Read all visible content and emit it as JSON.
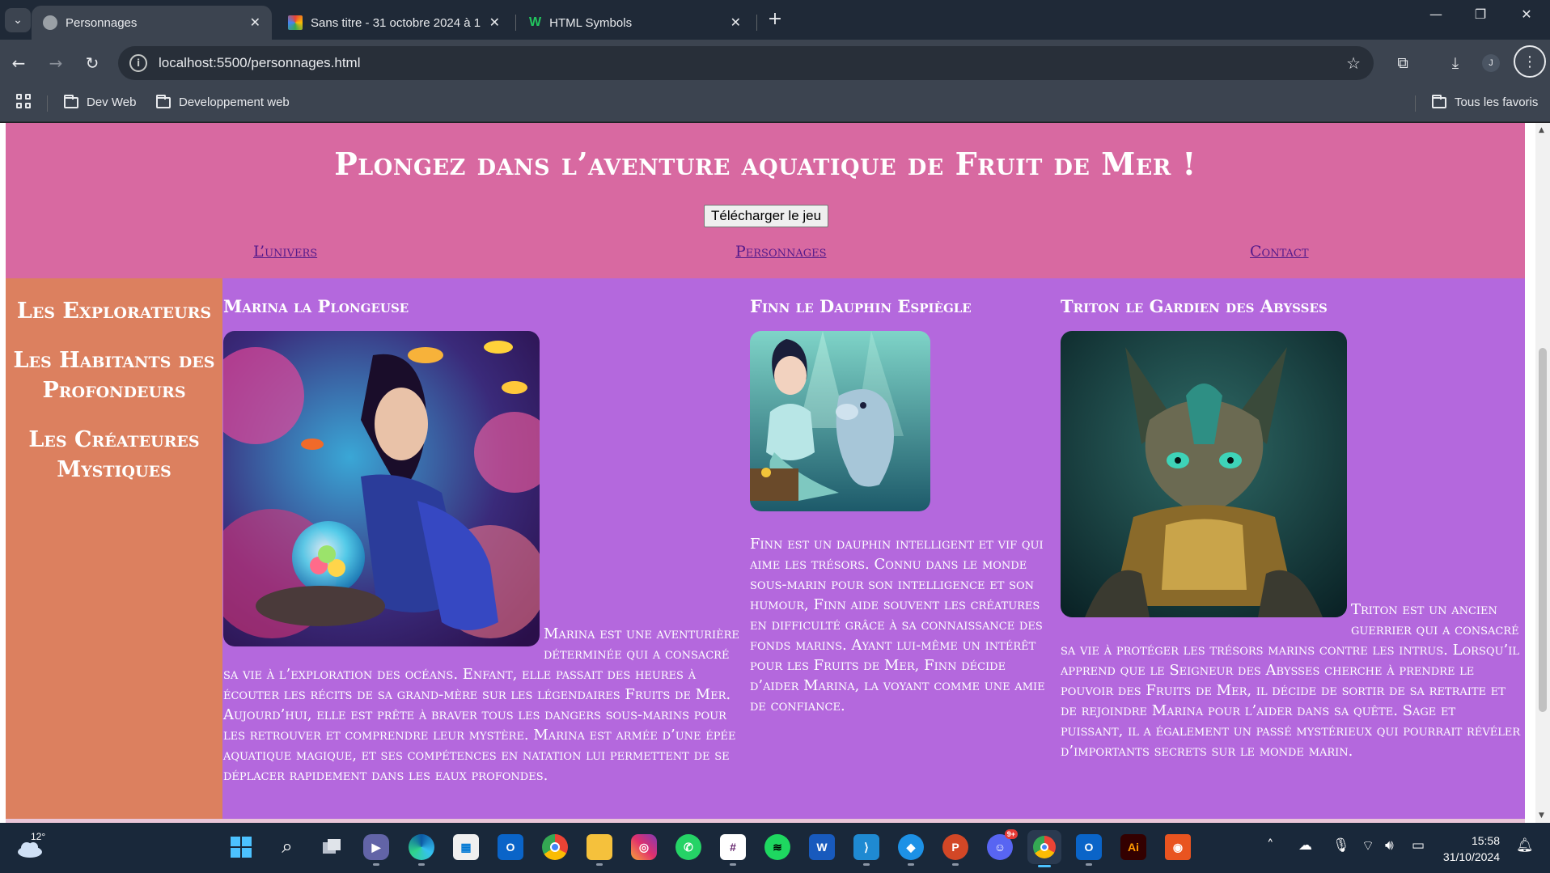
{
  "browser": {
    "tabs": [
      {
        "title": "Personnages",
        "active": true
      },
      {
        "title": "Sans titre - 31 octobre 2024 à 1",
        "active": false
      },
      {
        "title": "HTML Symbols",
        "active": false
      }
    ],
    "url": "localhost:5500/personnages.html",
    "bookmarks": [
      "Dev Web",
      "Developpement web"
    ],
    "all_bookmarks": "Tous les favoris",
    "profile_initial": "J"
  },
  "page": {
    "title": "Plongez dans l’aventure aquatique de Fruit de Mer !",
    "download_button": "Télécharger le jeu",
    "nav": [
      "L’univers",
      "Personnages",
      "Contact"
    ],
    "sidebar": [
      "Les Explorateurs",
      "Les Habitants des Profondeurs",
      "Les Créateures Mystiques"
    ],
    "characters": [
      {
        "name": "Marina la Plongeuse",
        "description": "Marina est une aventurière déterminée qui a consacré sa vie à l’exploration des océans. Enfant, elle passait des heures à écouter les récits de sa grand-mère sur les légendaires Fruits de Mer. Aujourd’hui, elle est prête à braver tous les dangers sous-marins pour les retrouver et comprendre leur mystère. Marina est armée d’une épée aquatique magique, et ses compétences en natation lui permettent de se déplacer rapidement dans les eaux profondes."
      },
      {
        "name": "Finn le Dauphin Espiègle",
        "description": "Finn est un dauphin intelligent et vif qui aime les trésors. Connu dans le monde sous-marin pour son intelligence et son humour, Finn aide souvent les créatures en difficulté grâce à sa connaissance des fonds marins. Ayant lui-même un intérêt pour les Fruits de Mer, Finn décide d’aider Marina, la voyant comme une amie de confiance."
      },
      {
        "name": "Triton le Gardien des Abysses",
        "description": "Triton est un ancien guerrier qui a consacré sa vie à protéger les trésors marins contre les intrus. Lorsqu’il apprend que le Seigneur des Abysses cherche à prendre le pouvoir des Fruits de Mer, il décide de sortir de sa retraite et de rejoindre Marina pour l’aider dans sa quête. Sage et puissant, il a également un passé mystérieux qui pourrait révéler d’importants secrets sur le monde marin."
      }
    ]
  },
  "taskbar": {
    "temperature": "12°",
    "time": "15:58",
    "date": "31/10/2024",
    "badge": "9+",
    "apps": [
      "windows-start",
      "search",
      "task-view",
      "teams",
      "edge",
      "store",
      "outlook",
      "chrome",
      "file-explorer",
      "instagram",
      "whatsapp",
      "slack",
      "spotify",
      "word",
      "vscode",
      "docker",
      "powerpoint",
      "discord",
      "chrome-profile",
      "outlook-2",
      "illustrator",
      "ubuntu"
    ]
  },
  "colors": {
    "header_bg": "#d869a1",
    "sidebar_bg": "#dc805f",
    "main_bg": "#b468dd",
    "nav_link": "#551a8b"
  }
}
